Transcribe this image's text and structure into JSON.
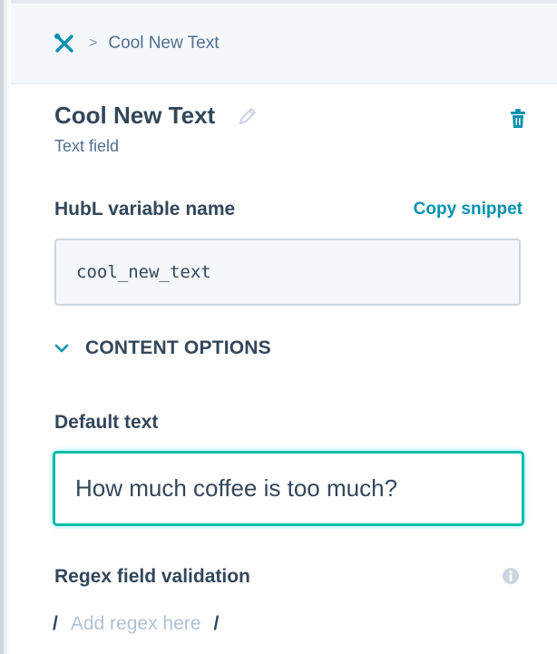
{
  "breadcrumb": {
    "icon": "crossed-tools-icon",
    "separator": ">",
    "current": "Cool New Text"
  },
  "field": {
    "title": "Cool New Text",
    "type_label": "Text field"
  },
  "hubl": {
    "label": "HubL variable name",
    "copy_label": "Copy snippet",
    "value": "cool_new_text"
  },
  "content_options": {
    "label": "CONTENT OPTIONS",
    "expanded": true
  },
  "default_text": {
    "label": "Default text",
    "value": "How much coffee is too much?"
  },
  "regex": {
    "label": "Regex field validation",
    "prefix": "/",
    "placeholder": "Add regex here",
    "suffix": "/"
  },
  "colors": {
    "accent": "#0091ae",
    "focus_border": "#00bda5",
    "text": "#33475b",
    "muted": "#516f90"
  }
}
